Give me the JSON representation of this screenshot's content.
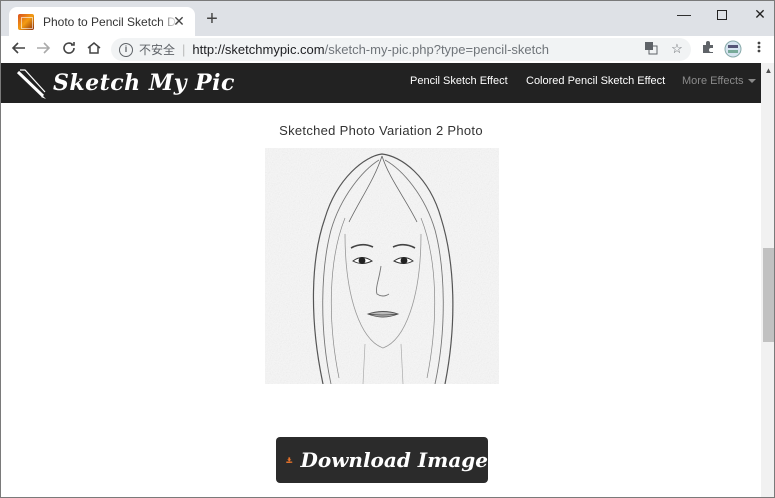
{
  "browser": {
    "tab_title": "Photo to Pencil Sketch Downlo",
    "tab_close": "✕",
    "new_tab": "+",
    "win_minimize": "—",
    "win_close": "✕",
    "insecure_label": "不安全",
    "url_host": "http://sketchmypic.com",
    "url_path": "/sketch-my-pic.php?type=pencil-sketch"
  },
  "site": {
    "brand": "Sketch My Pic",
    "nav": [
      {
        "label": "Pencil Sketch Effect"
      },
      {
        "label": "Colored Pencil Sketch Effect"
      },
      {
        "label": "More Effects"
      }
    ]
  },
  "main": {
    "heading": "Sketched Photo Variation 2 Photo",
    "download_label": "Download Image"
  },
  "colors": {
    "navbar": "#222222",
    "button": "#2b2b2b",
    "download_icon": "#e8732a"
  },
  "icons": [
    "back-icon",
    "forward-icon",
    "reload-icon",
    "home-icon",
    "info-icon",
    "translate-icon",
    "star-icon",
    "extensions-icon",
    "profile-icon",
    "menu-icon",
    "download-icon",
    "pencil-logo-icon"
  ]
}
